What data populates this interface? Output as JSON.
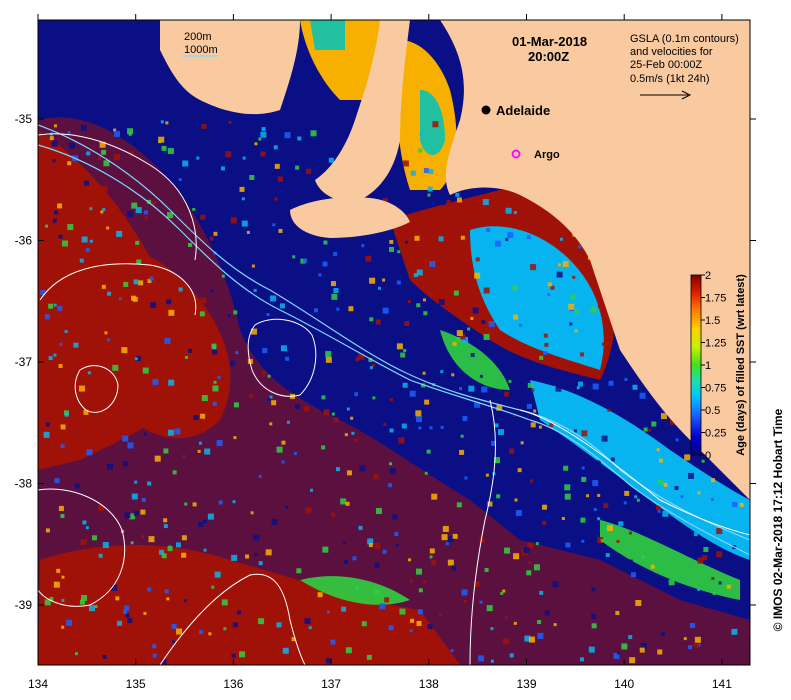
{
  "map": {
    "date": "01-Mar-2018",
    "time": "20:00Z",
    "gsla_line1": "GSLA (0.1m contours)",
    "gsla_line2": "and velocities for",
    "gsla_line3": "25-Feb 00:00Z",
    "gsla_line4": "0.5m/s (1kt 24h)",
    "contour_200": "200m",
    "contour_1000": "1000m",
    "city": "Adelaide",
    "argo": "Argo",
    "credit": "© IMOS 02-Mar-2018 17:12 Hobart Time",
    "x_ticks": [
      "134",
      "135",
      "136",
      "137",
      "138",
      "139",
      "140",
      "141"
    ],
    "y_ticks": [
      "-35",
      "-36",
      "-37",
      "-38",
      "-39"
    ]
  },
  "colorbar": {
    "label": "Age (days) of filled SST (wrt latest)",
    "ticks": [
      "2",
      "1.75",
      "1.5",
      "1.25",
      "1",
      "0.75",
      "0.5",
      "0.25",
      "0"
    ],
    "colors": [
      "#00007f",
      "#0000d0",
      "#1a60ff",
      "#00c8ff",
      "#20e0a0",
      "#40e020",
      "#c8f000",
      "#ffd000",
      "#ff8000",
      "#e02000",
      "#800000"
    ]
  },
  "colors": {
    "land": "#f9c9a0",
    "ocean_deep": "#0b0f86",
    "ocean_mid": "#1525b8",
    "age_old": "#a01208",
    "age_cyan": "#08b4f0",
    "age_green": "#30d040",
    "age_yellow": "#f8b000",
    "age_teal": "#20c0a0"
  }
}
